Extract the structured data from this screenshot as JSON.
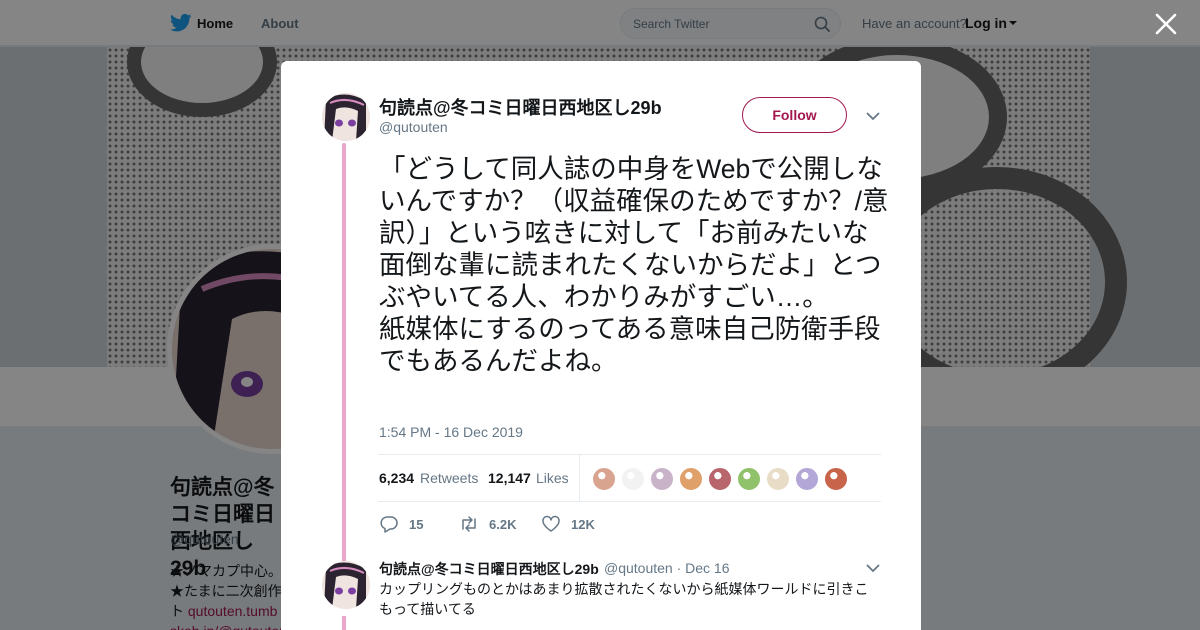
{
  "nav": {
    "home": "Home",
    "about": "About",
    "search_placeholder": "Search Twitter",
    "have_account": "Have an account?",
    "login": "Log in"
  },
  "profile": {
    "name": "句読点@冬コミ日曜日西地区し29b",
    "handle": "@qutouten",
    "bio_line1": "★ノマカプ中心。",
    "bio_line2": "★たまに二次創作",
    "bio_link_prefix": "ト ",
    "bio_link": "qutouten.tumb",
    "bio_link2": "skeb.jp/@qutouten"
  },
  "tweet": {
    "author_name": "句読点@冬コミ日曜日西地区し29b",
    "author_handle": "@qutouten",
    "follow_label": "Follow",
    "text": "「どうして同人誌の中身をWebで公開しないんですか？（収益確保のためですか？/意訳）」という呟きに対して「お前みたいな面倒な輩に読まれたくないからだよ」とつぶやいてる人、わかりみがすごい…。\n紙媒体にするのってある意味自己防衛手段でもあるんだよね。",
    "timestamp": "1:54 PM - 16 Dec 2019",
    "retweets_count": "6,234",
    "retweets_label": "Retweets",
    "likes_count": "12,147",
    "likes_label": "Likes",
    "reply_action_count": "15",
    "retweet_action_count": "6.2K",
    "like_action_count": "12K"
  },
  "likers": [
    {
      "icon": "liker-avatar-1",
      "color": "#d9a48f"
    },
    {
      "icon": "liker-avatar-2",
      "color": "#f2f2f2"
    },
    {
      "icon": "liker-avatar-3",
      "color": "#c9b3c9"
    },
    {
      "icon": "liker-avatar-4",
      "color": "#e0a06a"
    },
    {
      "icon": "liker-avatar-5",
      "color": "#b8656b"
    },
    {
      "icon": "liker-avatar-6",
      "color": "#8fc26a"
    },
    {
      "icon": "liker-avatar-7",
      "color": "#e8dcc6"
    },
    {
      "icon": "liker-avatar-8",
      "color": "#b2a7d6"
    },
    {
      "icon": "liker-avatar-9",
      "color": "#c8644a"
    }
  ],
  "reply": {
    "author_name": "句読点@冬コミ日曜日西地区し29b",
    "meta": "@qutouten · Dec 16",
    "text": "カップリングものとかはあまり拡散されたくないから紙媒体ワールドに引きこもって描いてる"
  },
  "colors": {
    "accent": "#a3174f",
    "thread_line": "#e8a6c8",
    "twitter_blue": "#1da1f2"
  }
}
